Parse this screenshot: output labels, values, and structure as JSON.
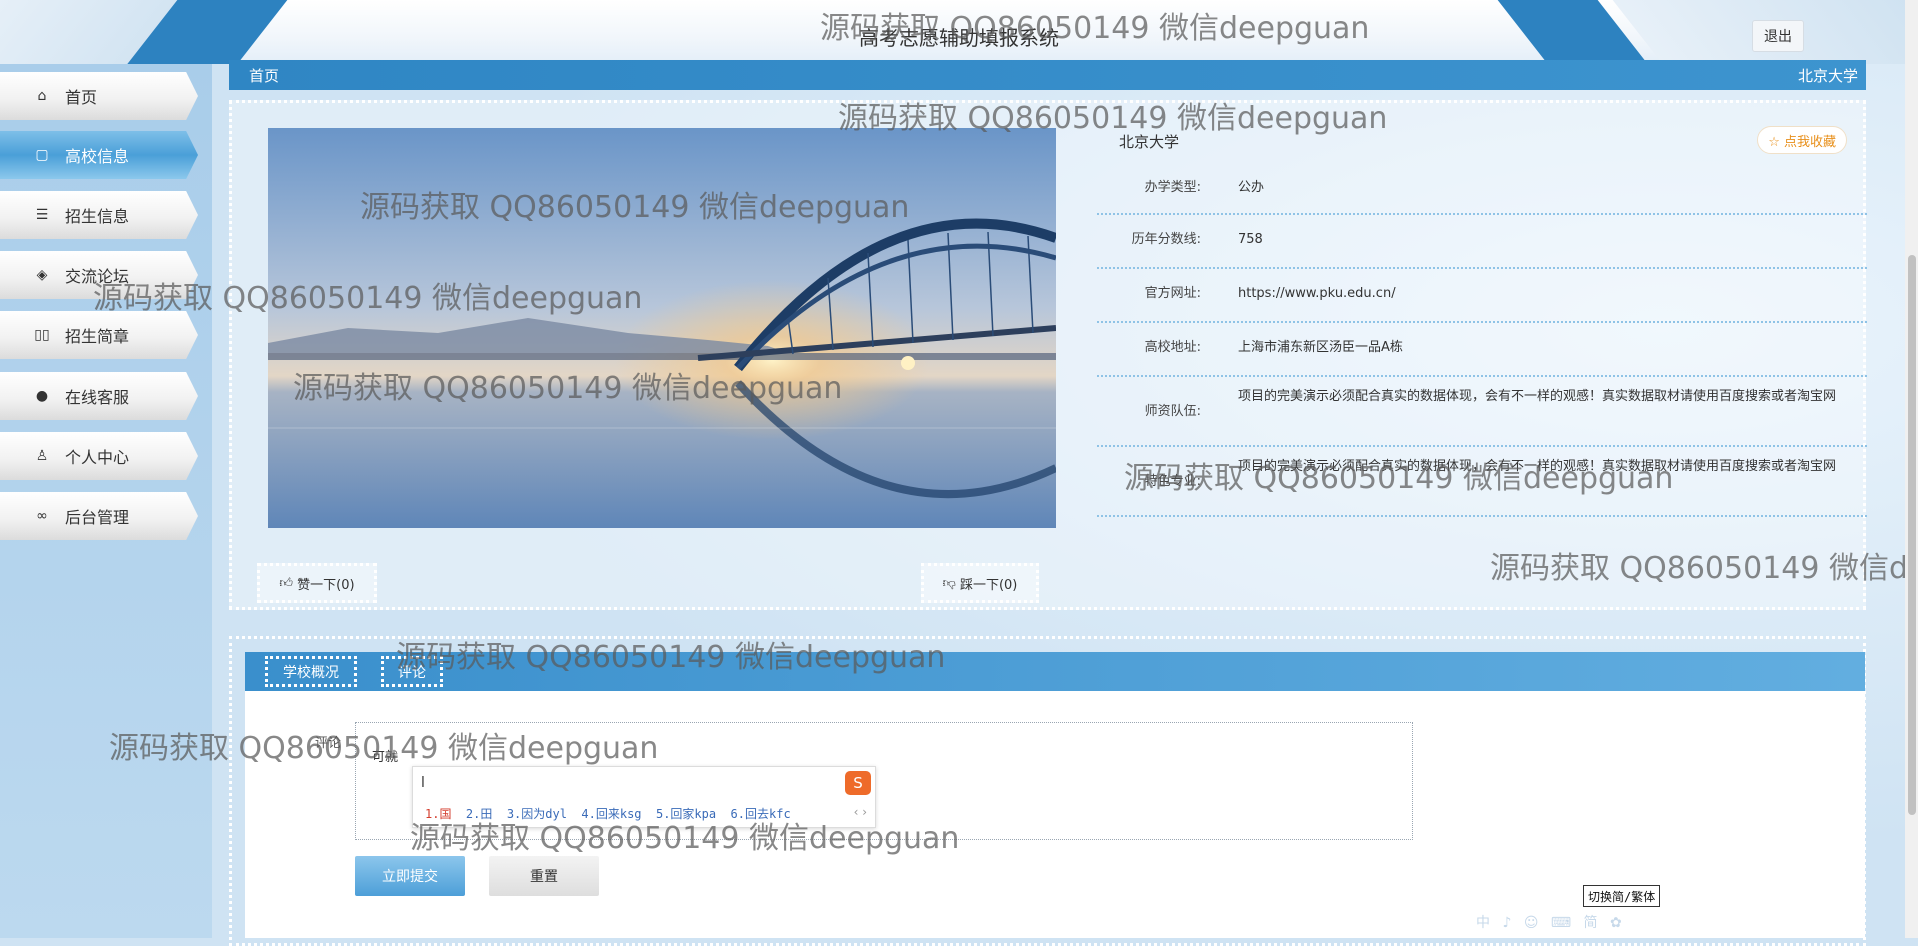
{
  "header": {
    "title": "高考志愿辅助填报系统",
    "logout_label": "退出"
  },
  "sidebar": {
    "items": [
      {
        "label": "首页",
        "icon": "home-icon",
        "glyph": "⌂"
      },
      {
        "label": "高校信息",
        "icon": "document-icon",
        "glyph": "▢"
      },
      {
        "label": "招生信息",
        "icon": "sliders-icon",
        "glyph": "☰"
      },
      {
        "label": "交流论坛",
        "icon": "layers-icon",
        "glyph": "◈"
      },
      {
        "label": "招生简章",
        "icon": "book-icon",
        "glyph": "▯▯"
      },
      {
        "label": "在线客服",
        "icon": "chat-icon",
        "glyph": "●"
      },
      {
        "label": "个人中心",
        "icon": "user-icon",
        "glyph": "♙"
      },
      {
        "label": "后台管理",
        "icon": "link-icon",
        "glyph": "∞"
      }
    ],
    "active_index": 1
  },
  "breadcrumb": {
    "left": "首页",
    "right": "北京大学"
  },
  "detail": {
    "name": "北京大学",
    "favorite_label": "☆ 点我收藏",
    "fields": [
      {
        "label": "办学类型:",
        "value": "公办"
      },
      {
        "label": "历年分数线:",
        "value": "758"
      },
      {
        "label": "官方网址:",
        "value": "https://www.pku.edu.cn/"
      },
      {
        "label": "高校地址:",
        "value": "上海市浦东新区汤臣一品A栋"
      },
      {
        "label": "师资队伍:",
        "value": "项目的完美演示必须配合真实的数据体现，会有不一样的观感！真实数据取材请使用百度搜索或者淘宝网"
      },
      {
        "label": "特色专业:",
        "value": "项目的完美演示必须配合真实的数据体现，会有不一样的观感！真实数据取材请使用百度搜索或者淘宝网"
      }
    ],
    "like_label": "赞一下(0)",
    "dislike_label": "踩一下(0)"
  },
  "tabs": [
    {
      "label": "学校概况"
    },
    {
      "label": "评论"
    }
  ],
  "comment": {
    "label": "评论",
    "value": "可就",
    "submit_label": "立即提交",
    "reset_label": "重置"
  },
  "ime": {
    "input": "l",
    "candidates": [
      "1.国",
      "2.田",
      "3.因为dyl",
      "4.回来ksg",
      "5.回家kpa",
      "6.回去kfc"
    ],
    "nav": "‹ ›",
    "switch_label": "切换简/繁体",
    "tray": "中 ♪ ☺ ⌨ 简 ✿"
  },
  "watermark": "源码获取 QQ86050149 微信deepguan",
  "colors": {
    "primary": "#2f86c4",
    "favorite": "#e8901c",
    "ime_highlight": "#d43c2c"
  }
}
